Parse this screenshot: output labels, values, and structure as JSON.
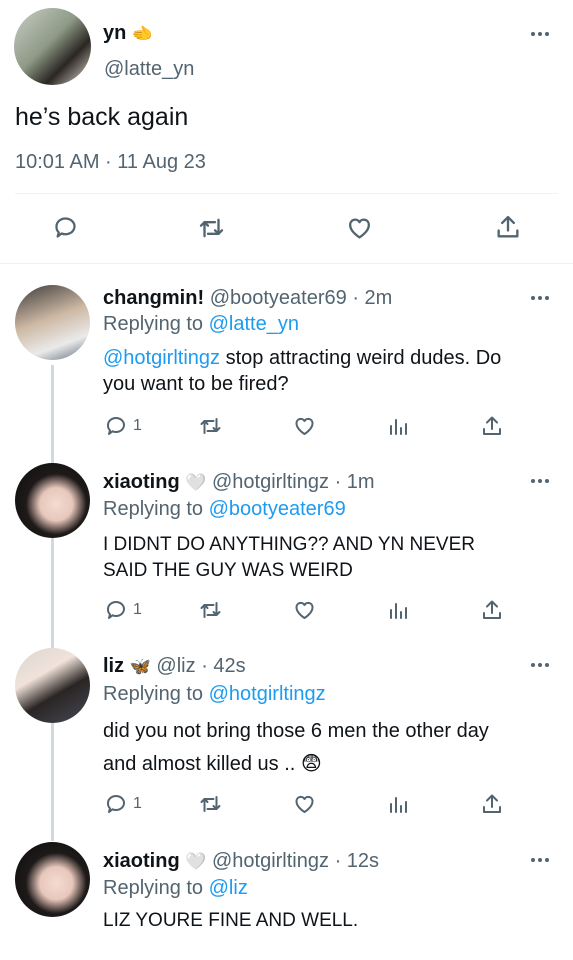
{
  "main_tweet": {
    "display_name": "yn",
    "name_emoji": "🫲",
    "handle": "@latte_yn",
    "text": "he’s back again",
    "timestamp": "10:01 AM · 11 Aug 23"
  },
  "replies": [
    {
      "display_name": "changmin!",
      "name_emoji": "",
      "handle": "@bootyeater69",
      "time": "· 2m",
      "replying_to_label": "Replying to",
      "replying_to": "@latte_yn",
      "mention": "@hotgirltingz",
      "text_line1": " stop attracting weird dudes. Do",
      "text_line2": "you want to be fired?",
      "reply_count": "1"
    },
    {
      "display_name": "xiaoting",
      "name_emoji": "🤍",
      "handle": "@hotgirltingz",
      "time": "· 1m",
      "replying_to_label": "Replying to",
      "replying_to": "@bootyeater69",
      "text_line1": "I DIDNT DO ANYTHING?? AND YN NEVER",
      "text_line2": "SAID THE GUY WAS WEIRD",
      "reply_count": "1"
    },
    {
      "display_name": "liz",
      "name_emoji": "🦋",
      "handle": "@liz",
      "time": "· 42s",
      "replying_to_label": "Replying to",
      "replying_to": "@hotgirltingz",
      "text_line1": "did you not bring those 6 men the other day",
      "text_line2": "and almost killed us .. 😨",
      "reply_count": "1"
    },
    {
      "display_name": "xiaoting",
      "name_emoji": "🤍",
      "handle": "@hotgirltingz",
      "time": "· 12s",
      "replying_to_label": "Replying to",
      "replying_to": "@liz",
      "text_line1": "LIZ YOURE FINE AND WELL."
    }
  ],
  "colors": {
    "link": "#1d9bf0",
    "muted": "#536471",
    "divider": "#eff3f4",
    "text": "#0f1419"
  },
  "icons": [
    "more-icon",
    "reply-icon",
    "retweet-icon",
    "like-icon",
    "share-icon",
    "analytics-icon"
  ]
}
